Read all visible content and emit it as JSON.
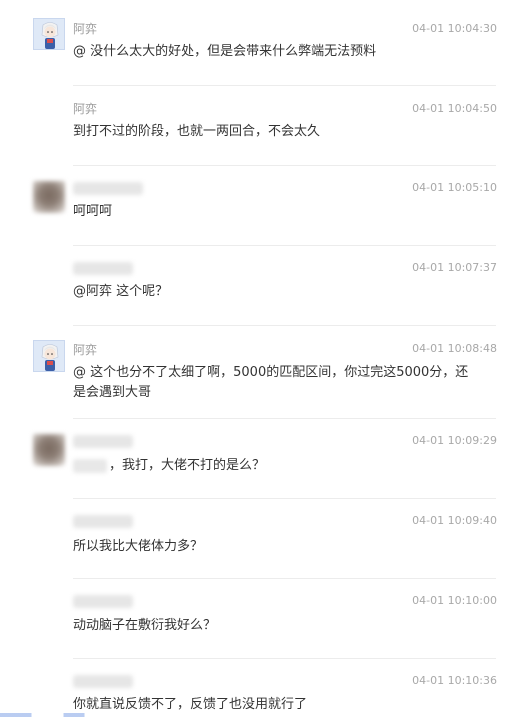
{
  "messages": [
    {
      "user": "阿弈",
      "time": "04-01 10:04:30",
      "text": "@  没什么太大的好处，但是会带来什么弊端无法预料",
      "avatar": "anime-avatar"
    },
    {
      "user": "阿弈",
      "time": "04-01 10:04:50",
      "text": "到打不过的阶段，也就一两回合，不会太久",
      "avatar": ""
    },
    {
      "user": "",
      "time": "04-01 10:05:10",
      "text": "呵呵呵",
      "avatar": "blurred-avatar"
    },
    {
      "user": "",
      "time": "04-01 10:07:37",
      "text": "@阿弈 这个呢？",
      "avatar": ""
    },
    {
      "user": "阿弈",
      "time": "04-01 10:08:48",
      "text": "@  这个也分不了太细了啊，5000的匹配区间，你过完这5000分，还是会遇到大哥",
      "avatar": "anime-avatar"
    },
    {
      "user": "",
      "time": "04-01 10:09:29",
      "text": "，我打，大佬不打的是么？",
      "avatar": "blurred-avatar"
    },
    {
      "user": "",
      "time": "04-01 10:09:40",
      "text": "所以我比大佬体力多？",
      "avatar": ""
    },
    {
      "user": "",
      "time": "04-01 10:10:00",
      "text": "动动脑子在敷衍我好么？",
      "avatar": ""
    },
    {
      "user": "",
      "time": "04-01 10:10:36",
      "text": "你就直说反馈不了，反馈了也没用就行了",
      "avatar": ""
    }
  ]
}
